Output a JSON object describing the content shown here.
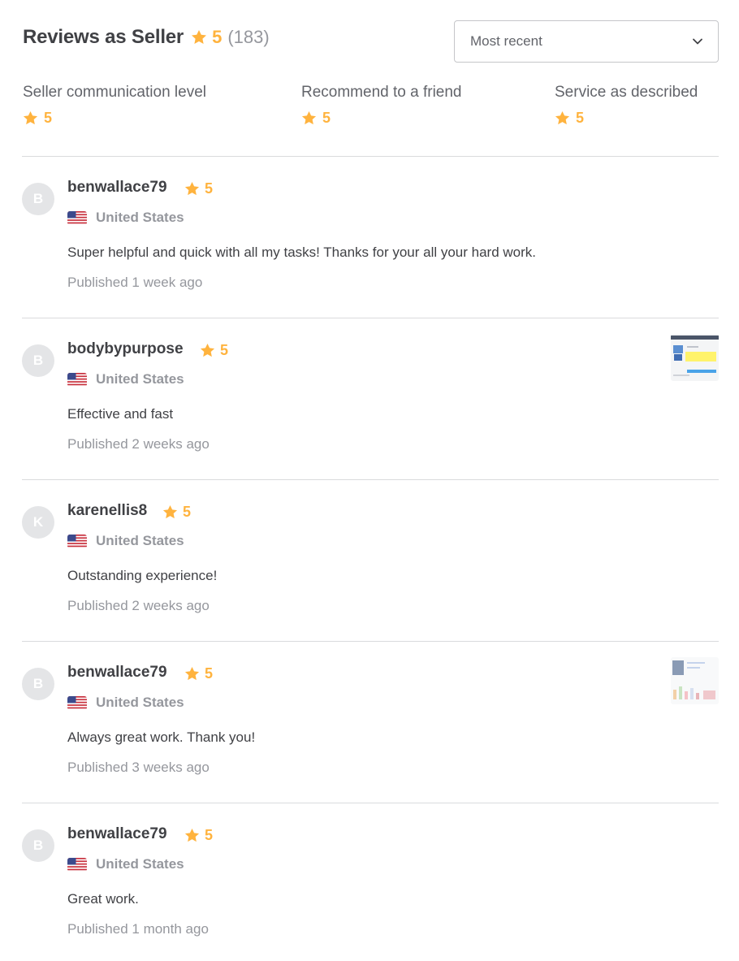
{
  "header": {
    "title": "Reviews as Seller",
    "rating": "5",
    "count": "(183)"
  },
  "sort": {
    "selected": "Most recent"
  },
  "categories": [
    {
      "label": "Seller communication level",
      "rating": "5"
    },
    {
      "label": "Recommend to a friend",
      "rating": "5"
    },
    {
      "label": "Service as described",
      "rating": "5"
    }
  ],
  "reviews": [
    {
      "initial": "B",
      "username": "benwallace79",
      "rating": "5",
      "country": "United States",
      "comment": "Super helpful and quick with all my tasks! Thanks for your all your hard work.",
      "published": "Published 1 week ago",
      "has_attachment": false
    },
    {
      "initial": "B",
      "username": "bodybypurpose",
      "rating": "5",
      "country": "United States",
      "comment": "Effective and fast",
      "published": "Published 2 weeks ago",
      "has_attachment": true
    },
    {
      "initial": "K",
      "username": "karenellis8",
      "rating": "5",
      "country": "United States",
      "comment": "Outstanding experience!",
      "published": "Published 2 weeks ago",
      "has_attachment": false
    },
    {
      "initial": "B",
      "username": "benwallace79",
      "rating": "5",
      "country": "United States",
      "comment": "Always great work. Thank you!",
      "published": "Published 3 weeks ago",
      "has_attachment": true
    },
    {
      "initial": "B",
      "username": "benwallace79",
      "rating": "5",
      "country": "United States",
      "comment": "Great work.",
      "published": "Published 1 month ago",
      "has_attachment": false
    }
  ],
  "colors": {
    "star": "#ffb33e",
    "text": "#404145",
    "muted": "#95979d",
    "divider": "#dadbdd",
    "avatar_bg": "#e4e5e7"
  },
  "icons": {
    "star": "star-icon",
    "chevron": "chevron-down-icon",
    "flag": "us-flag-icon"
  }
}
